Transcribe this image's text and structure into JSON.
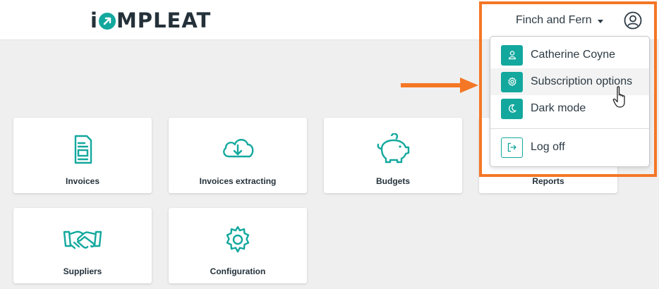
{
  "header": {
    "logo": {
      "prefix": "i",
      "rest": "MPLEAT"
    },
    "organization": "Finch and Fern"
  },
  "user_menu": {
    "items": [
      {
        "label": "Catherine Coyne",
        "icon": "user-icon"
      },
      {
        "label": "Subscription options",
        "icon": "gear-icon"
      },
      {
        "label": "Dark mode",
        "icon": "moon-icon"
      },
      {
        "label": "Log off",
        "icon": "logout-icon"
      }
    ]
  },
  "tiles": [
    {
      "label": "Invoices",
      "icon": "invoice-document-icon"
    },
    {
      "label": "Invoices extracting",
      "icon": "cloud-download-icon"
    },
    {
      "label": "Budgets",
      "icon": "piggy-bank-icon"
    },
    {
      "label": "Reports",
      "icon": "reports-icon"
    },
    {
      "label": "Suppliers",
      "icon": "handshake-icon"
    },
    {
      "label": "Configuration",
      "icon": "gear-icon"
    }
  ],
  "colors": {
    "accent": "#13a89e",
    "highlight": "#f47725",
    "text": "#24313a"
  }
}
